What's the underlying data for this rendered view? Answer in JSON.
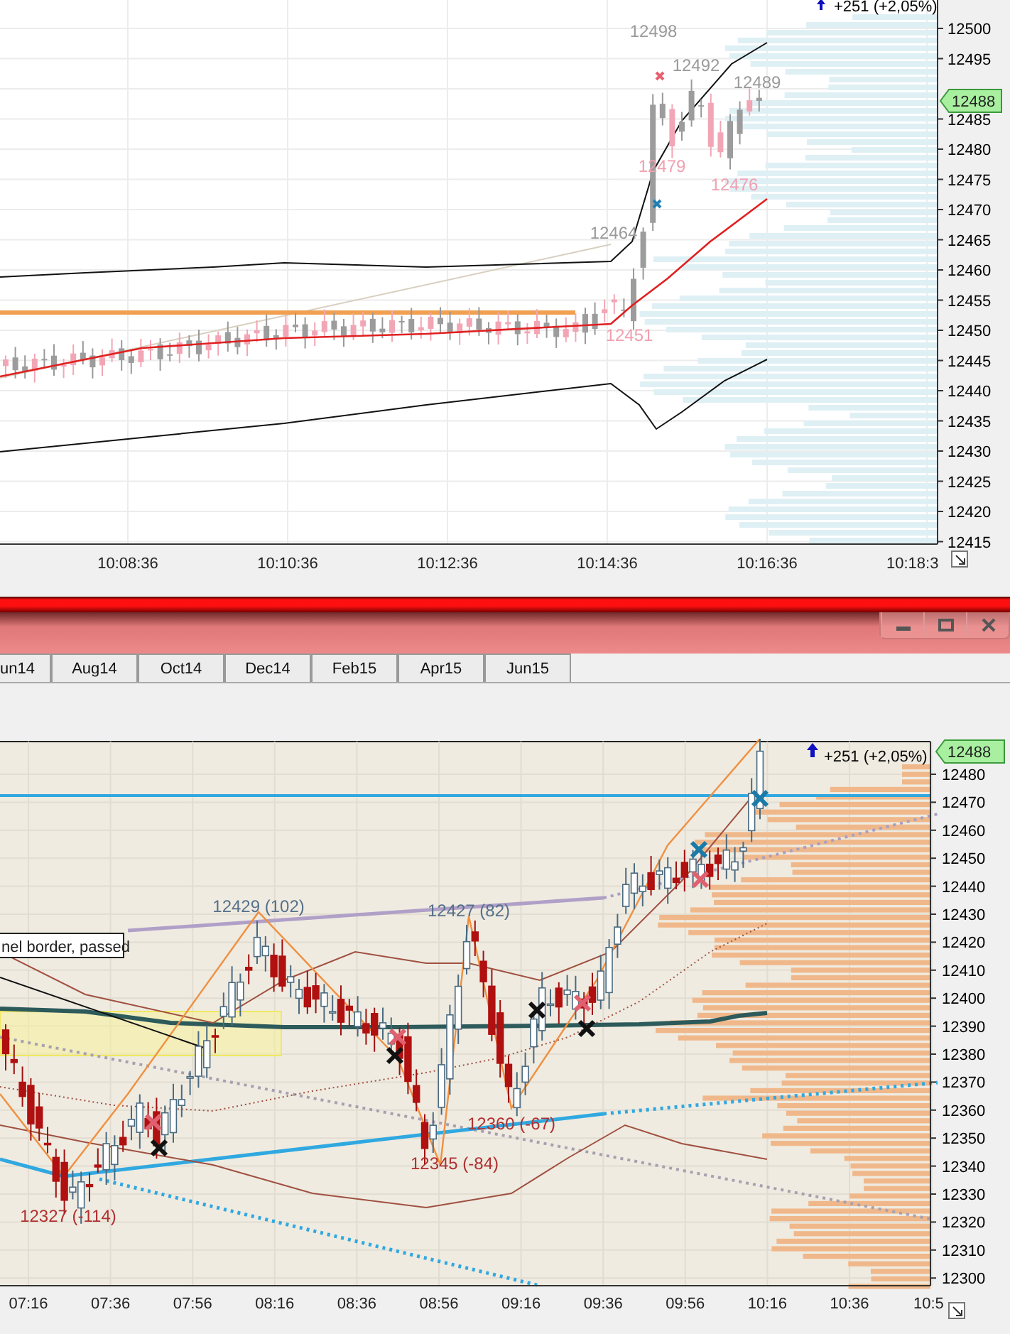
{
  "top_chart": {
    "change_label": "+251 (+2,05%)",
    "price_badge": "12488",
    "price_ticks": [
      "12500",
      "12495",
      "12485",
      "12480",
      "12475",
      "12470",
      "12465",
      "12460",
      "12455",
      "12450",
      "12445",
      "12440",
      "12435",
      "12430",
      "12425",
      "12420",
      "12415"
    ],
    "time_ticks": [
      "10:08:36",
      "10:10:36",
      "10:12:36",
      "10:14:36",
      "10:16:36",
      "10:18:3"
    ],
    "annotations": [
      {
        "text": "12498",
        "kind": "high"
      },
      {
        "text": "12492",
        "kind": "high"
      },
      {
        "text": "12489",
        "kind": "high"
      },
      {
        "text": "12479",
        "kind": "low"
      },
      {
        "text": "12476",
        "kind": "low"
      },
      {
        "text": "12464",
        "kind": "high"
      },
      {
        "text": "12451",
        "kind": "low"
      }
    ]
  },
  "tabs": [
    {
      "label": "un14",
      "selected": false
    },
    {
      "label": "Aug14",
      "selected": false
    },
    {
      "label": "Oct14",
      "selected": false
    },
    {
      "label": "Dec14",
      "selected": false
    },
    {
      "label": "Feb15",
      "selected": false
    },
    {
      "label": "Apr15",
      "selected": false
    },
    {
      "label": "Jun15",
      "selected": false
    }
  ],
  "bottom_chart": {
    "change_label": "+251 (+2,05%)",
    "price_badge": "12488",
    "tooltip": "nel border, passed",
    "price_ticks": [
      "12480",
      "12470",
      "12460",
      "12450",
      "12440",
      "12430",
      "12420",
      "12410",
      "12400",
      "12390",
      "12380",
      "12370",
      "12360",
      "12350",
      "12340",
      "12330",
      "12320",
      "12310",
      "12300"
    ],
    "time_ticks": [
      "07:16",
      "07:36",
      "07:56",
      "08:16",
      "08:36",
      "08:56",
      "09:16",
      "09:36",
      "09:56",
      "10:16",
      "10:36",
      "10:5"
    ],
    "annotations": [
      {
        "text": "12429 (102)",
        "kind": "high"
      },
      {
        "text": "12427 (82)",
        "kind": "high"
      },
      {
        "text": "12360 (-67)",
        "kind": "low"
      },
      {
        "text": "12345 (-84)",
        "kind": "low"
      },
      {
        "text": "12327 (-114)",
        "kind": "low"
      }
    ]
  }
}
